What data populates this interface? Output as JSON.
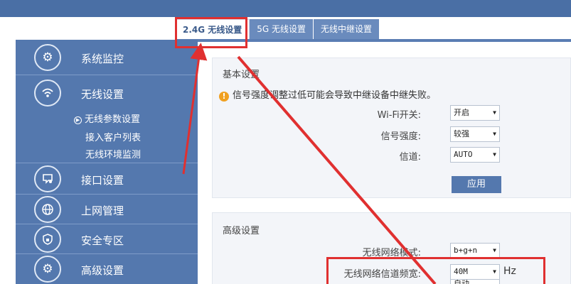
{
  "tabs": [
    {
      "label": "2.4G 无线设置",
      "active": true
    },
    {
      "label": "5G 无线设置",
      "active": false
    },
    {
      "label": "无线中继设置",
      "active": false
    }
  ],
  "sidebar": {
    "items": [
      {
        "label": "系统监控",
        "icon": "gear-monitor-icon"
      },
      {
        "label": "无线设置",
        "icon": "wifi-icon"
      },
      {
        "label": "接口设置",
        "icon": "interface-icon"
      },
      {
        "label": "上网管理",
        "icon": "globe-icon"
      },
      {
        "label": "安全专区",
        "icon": "shield-icon"
      },
      {
        "label": "高级设置",
        "icon": "gear-icon"
      }
    ],
    "subitems": [
      {
        "label": "无线参数设置",
        "active": true
      },
      {
        "label": "接入客户列表",
        "active": false
      },
      {
        "label": "无线环境监测",
        "active": false
      }
    ]
  },
  "basic": {
    "title": "基本设置",
    "warning": "信号强度调整过低可能会导致中继设备中继失败。",
    "wifi_label": "Wi-Fi开关:",
    "wifi_value": "开启",
    "strength_label": "信号强度:",
    "strength_value": "较强",
    "channel_label": "信道:",
    "channel_value": "AUTO",
    "apply_label": "应用"
  },
  "advanced": {
    "title": "高级设置",
    "mode_label": "无线网络模式:",
    "mode_value": "b+g+n",
    "bandwidth_label": "无线网络信道频宽:",
    "bandwidth_value": "40M",
    "bandwidth_unit": "Hz",
    "next_value": "自动"
  },
  "colors": {
    "highlight": "#e03030",
    "sidebar": "#5478ae",
    "topbar": "#4a6fa5"
  }
}
